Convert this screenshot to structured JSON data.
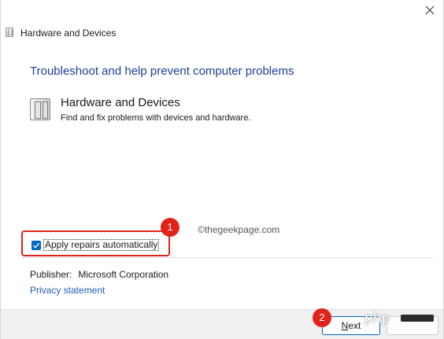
{
  "window": {
    "title": "Hardware and Devices"
  },
  "main": {
    "heading": "Troubleshoot and help prevent computer problems",
    "item": {
      "title": "Hardware and Devices",
      "description": "Find and fix problems with devices and hardware."
    },
    "watermark": "©thegeekpage.com",
    "apply_repairs": {
      "label": "Apply repairs automatically",
      "checked": true
    },
    "publisher": {
      "label": "Publisher:",
      "value": "Microsoft Corporation"
    },
    "privacy_link": "Privacy statement"
  },
  "annotations": {
    "badge1": "1",
    "badge2": "2"
  },
  "footer": {
    "next_first": "N",
    "next_rest": "ext",
    "php_logo": "php"
  },
  "colors": {
    "accent": "#0067c0",
    "heading": "#1c3f94",
    "annotation": "#e0241b",
    "link": "#1c5fb0"
  }
}
